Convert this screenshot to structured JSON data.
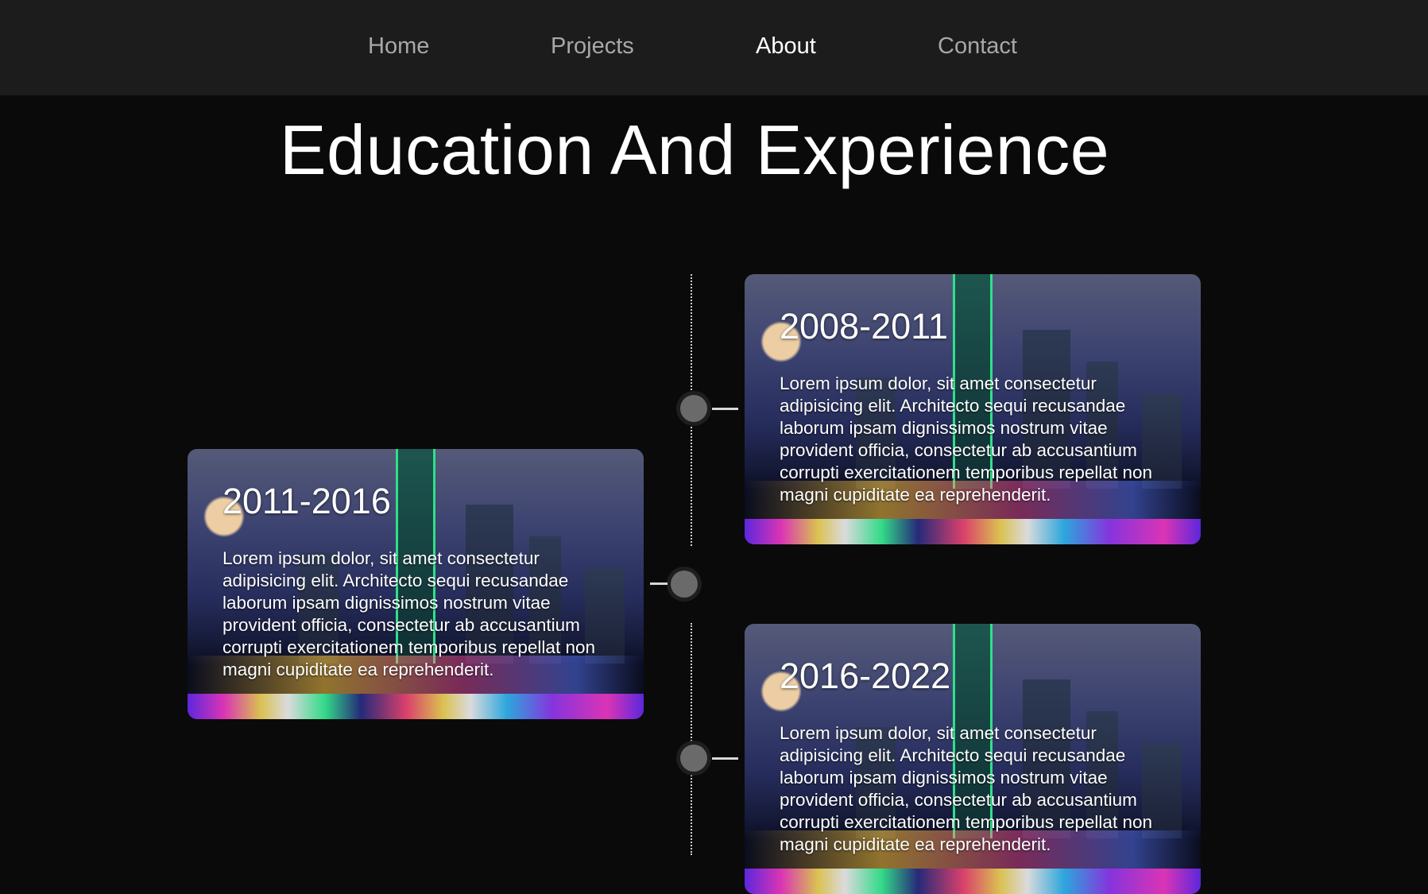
{
  "nav": {
    "items": [
      {
        "label": "Home",
        "active": false
      },
      {
        "label": "Projects",
        "active": false
      },
      {
        "label": "About",
        "active": true
      },
      {
        "label": "Contact",
        "active": false
      }
    ]
  },
  "page_title": "Education And Experience",
  "timeline": [
    {
      "years": "2008-2011",
      "side": "right",
      "text": "Lorem ipsum dolor, sit amet consectetur adipisicing elit. Architecto sequi recusandae laborum ipsam dignissimos nostrum vitae provident officia, consectetur ab accusantium corrupti exercitationem temporibus repellat non magni cupiditate ea reprehenderit."
    },
    {
      "years": "2011-2016",
      "side": "left",
      "text": "Lorem ipsum dolor, sit amet consectetur adipisicing elit. Architecto sequi recusandae laborum ipsam dignissimos nostrum vitae provident officia, consectetur ab accusantium corrupti exercitationem temporibus repellat non magni cupiditate ea reprehenderit."
    },
    {
      "years": "2016-2022",
      "side": "right",
      "text": "Lorem ipsum dolor, sit amet consectetur adipisicing elit. Architecto sequi recusandae laborum ipsam dignissimos nostrum vitae provident officia, consectetur ab accusantium corrupti exercitationem temporibus repellat non magni cupiditate ea reprehenderit."
    }
  ],
  "colors": {
    "background": "#0a0a0a",
    "nav_background": "#1c1c1c",
    "nav_text": "#a8a8a8",
    "nav_active": "#ffffff",
    "timeline_dot": "#6a6a6a"
  }
}
